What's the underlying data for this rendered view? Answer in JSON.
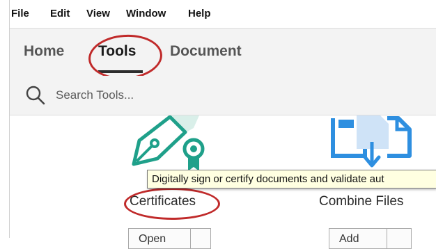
{
  "menubar": {
    "items": [
      {
        "label": "File"
      },
      {
        "label": "Edit"
      },
      {
        "label": "View"
      },
      {
        "label": "Window"
      },
      {
        "label": "Help"
      }
    ]
  },
  "tabs": [
    {
      "label": "Home",
      "active": false
    },
    {
      "label": "Tools",
      "active": true
    },
    {
      "label": "Document",
      "active": false
    }
  ],
  "search": {
    "placeholder": "Search Tools...",
    "icon": "search-icon"
  },
  "tools": [
    {
      "label": "Certificates",
      "icon": "certificate-pen-icon",
      "button_label": "Open",
      "icon_color": "#1fa08a"
    },
    {
      "label": "Combine Files",
      "icon": "combine-files-icon",
      "button_label": "Add",
      "icon_color": "#2e8fe0"
    }
  ],
  "tooltip": {
    "text": "Digitally sign or certify documents and validate aut"
  },
  "colors": {
    "highlight_circle": "#c02a2a",
    "tooltip_bg": "#ffffe1",
    "certificate_teal": "#1fa08a",
    "combine_blue": "#2e8fe0"
  }
}
